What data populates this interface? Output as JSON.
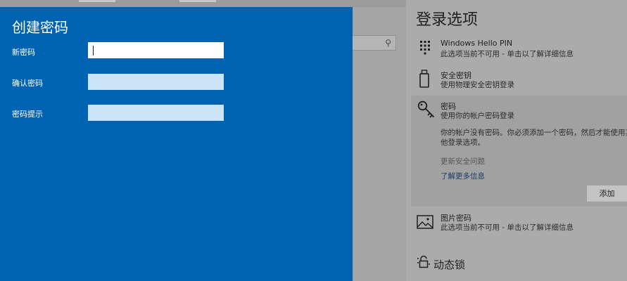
{
  "dialog": {
    "title": "创建密码",
    "fields": [
      {
        "label": "新密码",
        "value": ""
      },
      {
        "label": "确认密码",
        "value": ""
      },
      {
        "label": "密码提示",
        "value": ""
      }
    ]
  },
  "settings": {
    "heading": "登录选项",
    "options": [
      {
        "title": "Windows Hello PIN",
        "subtitle": "此选项当前不可用 - 单击以了解详细信息",
        "icon": "keypad-icon"
      },
      {
        "title": "安全密钥",
        "subtitle": "使用物理安全密钥登录",
        "icon": "usb-key-icon"
      },
      {
        "title": "密码",
        "subtitle": "使用你的帐户密码登录",
        "icon": "key-icon",
        "description_line1": "你的帐户没有密码。你必须添加一个密码，然后才能使用其",
        "description_line2": "他登录选项。",
        "update_security_questions": "更新安全问题",
        "learn_more": "了解更多信息",
        "add_button": "添加"
      },
      {
        "title": "图片密码",
        "subtitle": "此选项当前不可用 - 单击以了解详细信息",
        "icon": "picture-icon"
      }
    ],
    "dynamic_lock": "动态锁"
  },
  "colors": {
    "dialog_bg": "#0063b1",
    "input_inactive": "#cce4f7",
    "input_active": "#ffffff"
  }
}
